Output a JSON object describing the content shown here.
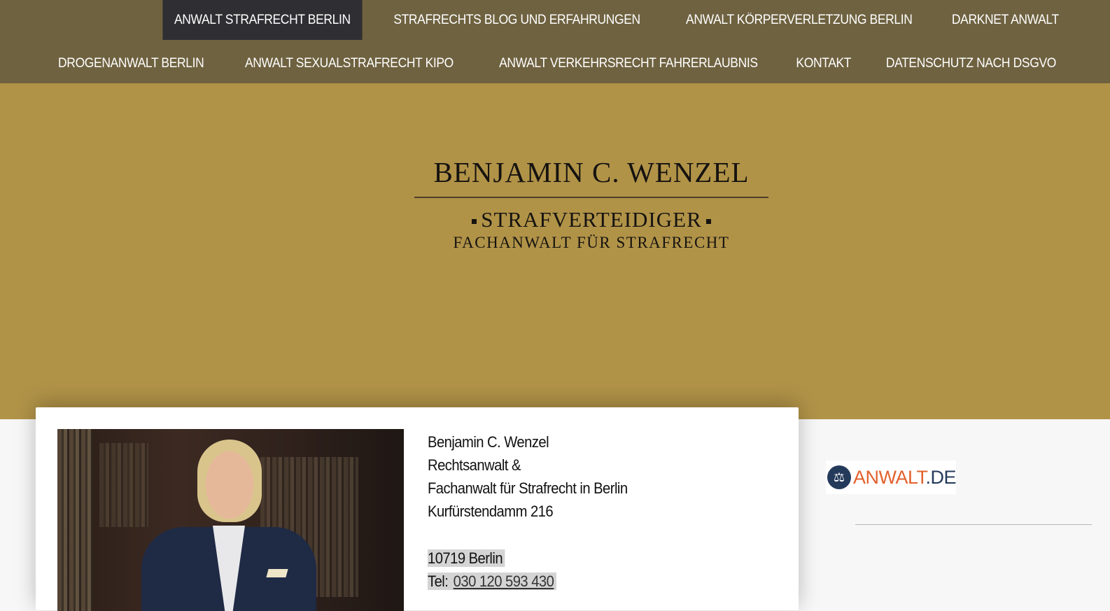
{
  "nav": {
    "row1": [
      {
        "label": "ANWALT STRAFRECHT BERLIN",
        "active": true
      },
      {
        "label": "STRAFRECHTS BLOG UND ERFAHRUNGEN"
      },
      {
        "label": "ANWALT KÖRPERVERLETZUNG BERLIN"
      },
      {
        "label": "DARKNET ANWALT"
      }
    ],
    "row2": [
      {
        "label": "DROGENANWALT BERLIN"
      },
      {
        "label": "ANWALT SEXUALSTRAFRECHT KIPO"
      },
      {
        "label": "ANWALT VERKEHRSRECHT FAHRERLAUBNIS"
      },
      {
        "label": "KONTAKT"
      },
      {
        "label": "DATENSCHUTZ NACH DSGVO"
      }
    ]
  },
  "logo": {
    "name": "BENJAMIN C. WENZEL",
    "subtitle": "STRAFVERTEIDIGER",
    "subtitle2": "FACHANWALT FÜR STRAFRECHT"
  },
  "contact": {
    "name": "Benjamin C. Wenzel",
    "title1": "Rechtsanwalt &",
    "title2": "Fachanwalt für Strafrecht in Berlin",
    "street": "Kurfürstendamm 216",
    "city": "10719 Berlin",
    "tel_label": "Tel:",
    "tel": "030 120 593 430"
  },
  "badge": {
    "text_main": "ANWALT",
    "text_suffix": ".DE",
    "icon": "scales-icon"
  },
  "colors": {
    "nav_bg": "#6f6240",
    "nav_active": "#2f2f33",
    "hero_bg": "#b19348",
    "badge_orange": "#e2612d",
    "badge_navy": "#243a5a"
  }
}
